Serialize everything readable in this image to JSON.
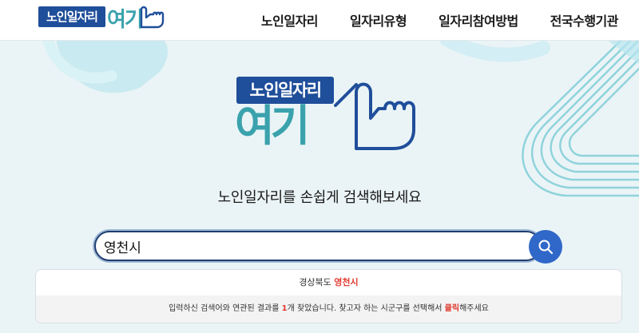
{
  "header": {
    "logo_box_text": "노인일자리",
    "logo_yeogi_text": "여기",
    "nav": [
      "노인일자리",
      "일자리유형",
      "일자리참여방법",
      "전국수행기관"
    ]
  },
  "hero": {
    "logo_box_text": "노인일자리",
    "logo_yeogi_text": "여기",
    "tagline": "노인일자리를 손쉽게 검색해보세요"
  },
  "search": {
    "value": "영천시",
    "placeholder": ""
  },
  "result": {
    "province": "경상북도",
    "city": "영천시",
    "msg_part1": "입력하신 검색어와 연관된 결과를 ",
    "count": "1",
    "msg_part2": "개 찾았습니다. 찾고자 하는 시군구를 선택해서 ",
    "click_word": "클릭",
    "msg_part3": "해주세요"
  },
  "colors": {
    "brand_blue": "#1f4e9a",
    "brand_teal": "#3aa2ad",
    "search_button": "#2f68c8",
    "highlight_red": "#e03a2f"
  },
  "icons": {
    "search_button": "search-icon",
    "logo_mark": "pointing-finger-icon"
  }
}
